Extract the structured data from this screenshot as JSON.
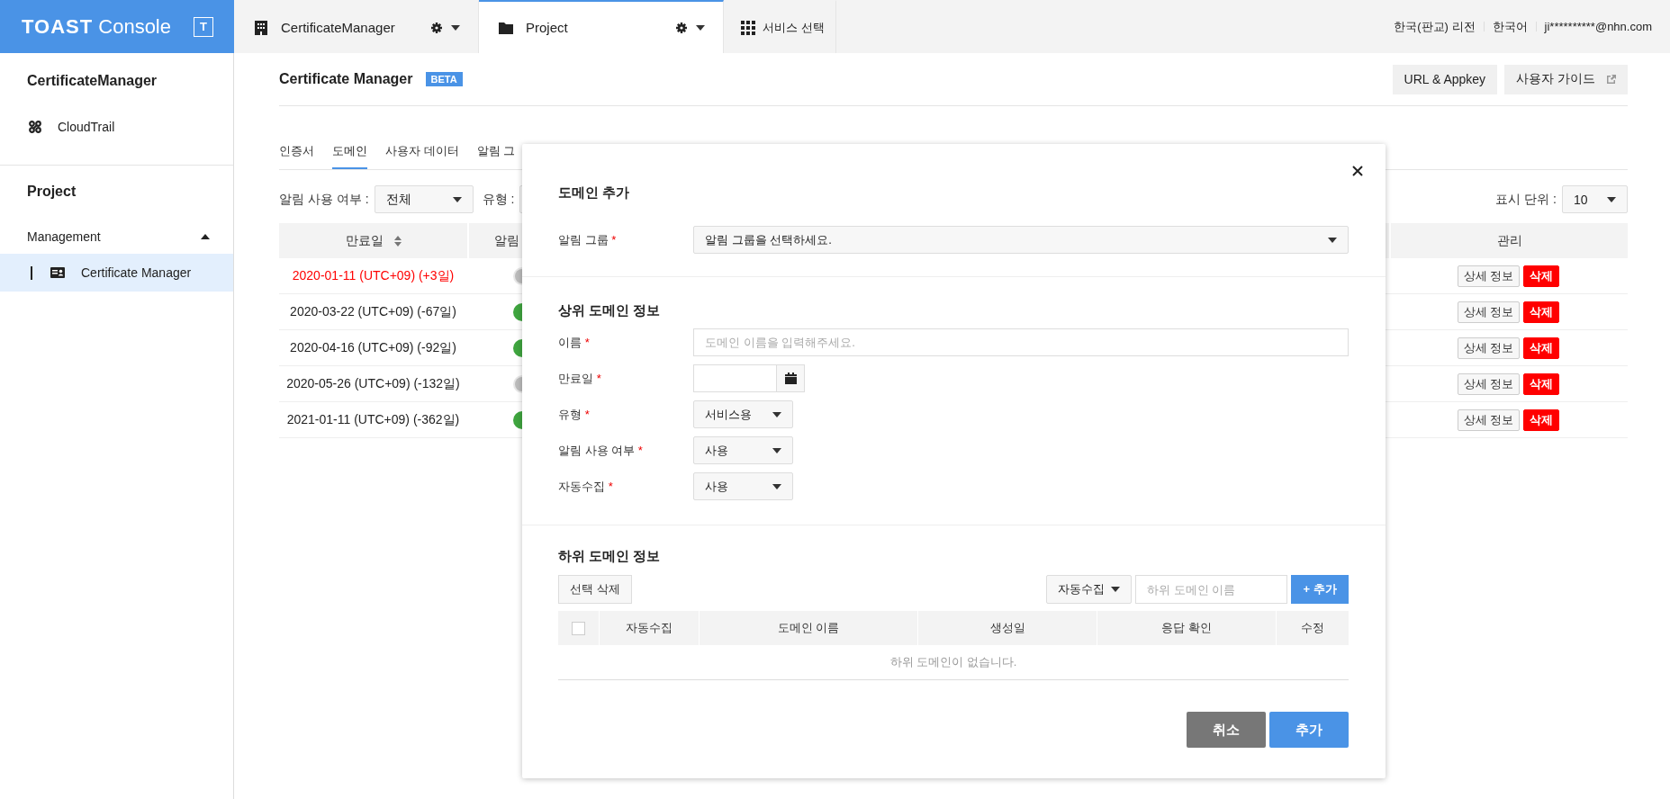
{
  "topbar": {
    "logo": "TOAST",
    "logo_suffix": "Console",
    "logo_badge": "T",
    "tabs": [
      {
        "kind": "org",
        "label": "CertificateManager",
        "selected": false,
        "settings": true
      },
      {
        "kind": "project",
        "label": "Project",
        "selected": true,
        "settings": true
      },
      {
        "kind": "services",
        "label": "서비스 선택",
        "selected": false,
        "settings": false
      }
    ],
    "links": [
      "한국(판교) 리전",
      "한국어",
      "ji**********@nhn.com"
    ]
  },
  "sidebar": {
    "org_title": "CertificateManager",
    "org_items": [
      {
        "label": "CloudTrail",
        "selected": false
      }
    ],
    "project_title": "Project",
    "groups": [
      {
        "label": "Management",
        "expanded": true,
        "items": [
          {
            "label": "Certificate Manager",
            "selected": true
          }
        ]
      }
    ]
  },
  "page": {
    "title": "Certificate Manager",
    "badge": "BETA",
    "buttons": [
      {
        "kind": "plain",
        "label": "URL & Appkey"
      },
      {
        "kind": "external",
        "label": "사용자 가이드"
      }
    ],
    "tabs": [
      {
        "label": "인증서",
        "selected": false
      },
      {
        "label": "도메인",
        "selected": true
      },
      {
        "label": "사용자 데이터",
        "selected": false
      },
      {
        "label": "알림 그",
        "selected": false
      }
    ],
    "filters": [
      {
        "label": "알림 사용 여부 :",
        "value": "전체"
      },
      {
        "label": "유형 :"
      }
    ],
    "page_size": {
      "label": "표시 단위 :",
      "value": "10"
    },
    "table": {
      "columns": [
        {
          "label": "만료일",
          "sortable": true
        },
        {
          "label": "알림",
          "sortable": false
        }
      ],
      "last_column": "관리",
      "rows": [
        {
          "expiry": "2020-01-11 (UTC+09) (+3일)",
          "expiring": true,
          "alert_on": false,
          "actions": [
            "상세 정보",
            "삭제"
          ]
        },
        {
          "expiry": "2020-03-22 (UTC+09) (-67일)",
          "expiring": false,
          "alert_on": true,
          "actions": [
            "상세 정보",
            "삭제"
          ]
        },
        {
          "expiry": "2020-04-16 (UTC+09) (-92일)",
          "expiring": false,
          "alert_on": true,
          "actions": [
            "상세 정보",
            "삭제"
          ]
        },
        {
          "expiry": "2020-05-26 (UTC+09) (-132일)",
          "expiring": false,
          "alert_on": false,
          "actions": [
            "상세 정보",
            "삭제"
          ]
        },
        {
          "expiry": "2021-01-11 (UTC+09) (-362일)",
          "expiring": false,
          "alert_on": true,
          "actions": [
            "상세 정보",
            "삭제"
          ]
        }
      ]
    }
  },
  "modal": {
    "title": "도메인 추가",
    "alert_group": {
      "label": "알림 그룹",
      "required_mark": "*",
      "placeholder": "알림 그룹을 선택하세요."
    },
    "parent_section": {
      "title": "상위 도메인 정보",
      "fields": [
        {
          "kind": "text",
          "label": "이름",
          "required_mark": "*",
          "placeholder": "도메인 이름을 입력해주세요."
        },
        {
          "kind": "date",
          "label": "만료일",
          "required_mark": "*"
        },
        {
          "kind": "select",
          "label": "유형",
          "required_mark": "*",
          "value": "서비스용"
        },
        {
          "kind": "select",
          "label": "알림 사용 여부",
          "required_mark": "*",
          "value": "사용"
        },
        {
          "kind": "select",
          "label": "자동수집",
          "required_mark": "*",
          "value": "사용"
        }
      ]
    },
    "sub_section": {
      "title": "하위 도메인 정보",
      "delete_button": "선택 삭제",
      "collect_select": "자동수집",
      "name_placeholder": "하위 도메인 이름",
      "add_button": "+ 추가",
      "table": {
        "select_all_checked": false,
        "columns": [
          "자동수집",
          "도메인 이름",
          "생성일",
          "응답 확인",
          "수정"
        ],
        "empty_text": "하위 도메인이 없습니다."
      }
    },
    "buttons": [
      {
        "kind": "secondary",
        "label": "취소"
      },
      {
        "kind": "primary",
        "label": "추가"
      }
    ]
  }
}
